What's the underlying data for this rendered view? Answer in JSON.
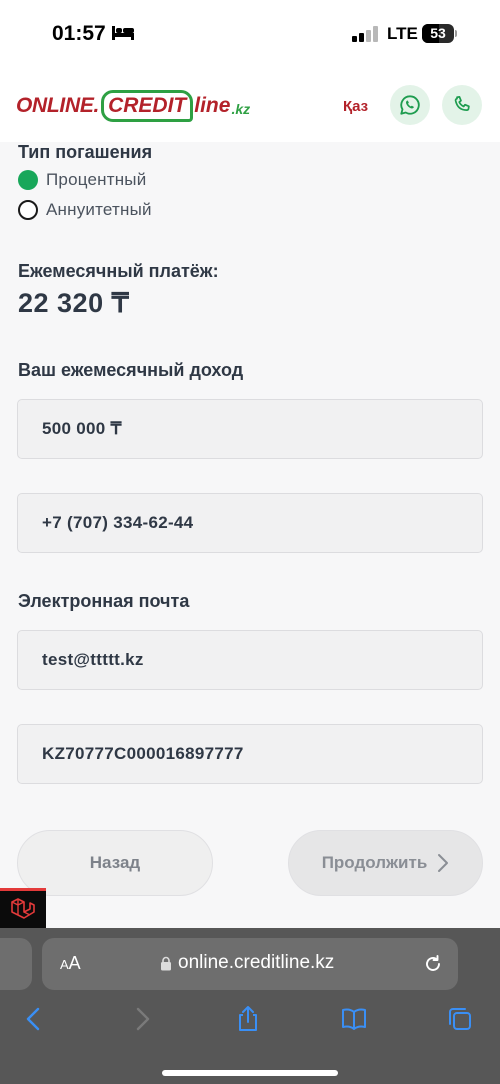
{
  "status_bar": {
    "time": "01:57",
    "network": "LTE",
    "battery": "53"
  },
  "header": {
    "logo": {
      "part1": "ONLINE.",
      "part2": "CREDIT",
      "part3": "line",
      "part4": ".kz"
    },
    "language": "Қаз"
  },
  "form": {
    "repayment": {
      "label": "Тип погашения",
      "options": [
        {
          "label": "Процентный",
          "selected": true
        },
        {
          "label": "Аннуитетный",
          "selected": false
        }
      ]
    },
    "monthly_payment": {
      "label": "Ежемесячный платёж:",
      "value": "22 320 ₸"
    },
    "income": {
      "label": "Ваш ежемесячный доход",
      "value": "500 000 ₸"
    },
    "phone": {
      "value": "+7 (707) 334-62-44"
    },
    "email": {
      "label": "Электронная почта",
      "value": "test@ttttt.kz"
    },
    "iban": {
      "value": "KZ70777C000016897777"
    },
    "buttons": {
      "back": "Назад",
      "next": "Продолжить"
    }
  },
  "browser": {
    "aa_small": "A",
    "aa_large": "A",
    "url": "online.creditline.kz"
  },
  "colors": {
    "brand_red": "#b3222a",
    "brand_green": "#2ea043",
    "radio_selected": "#18a75a"
  }
}
